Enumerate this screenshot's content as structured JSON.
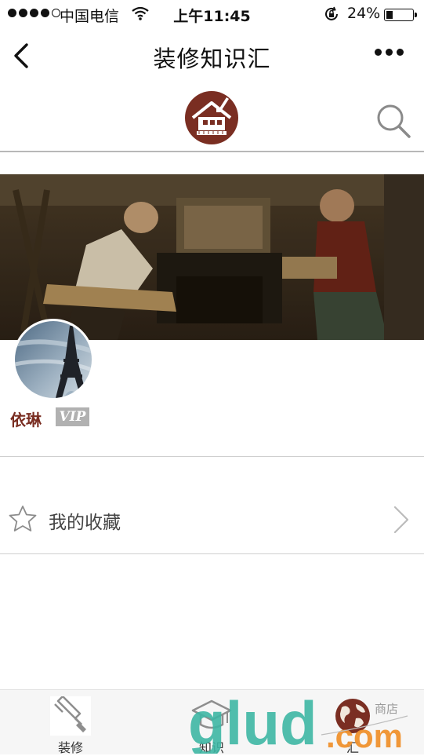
{
  "status_bar": {
    "carrier": "中国电信",
    "time": "上午11:45",
    "battery_percent": "24%",
    "battery_level": 0.24
  },
  "nav": {
    "title": "装修知识汇"
  },
  "profile": {
    "username": "依琳",
    "badge": "VIP"
  },
  "favorites": {
    "label": "我的收藏"
  },
  "tabs": [
    {
      "label": "装修",
      "icon": "paint-roller-icon"
    },
    {
      "label": "知识",
      "icon": "graduation-cap-icon"
    },
    {
      "label": "汇",
      "icon": "globe-icon"
    }
  ],
  "watermark": {
    "brand": "glud",
    "suffix": ".com",
    "shop": "商店"
  },
  "colors": {
    "brand": "#7a2e22",
    "divider": "#cfcfcf",
    "vip_badge": "#b1b1b1",
    "watermark_teal": "#3fb7a5",
    "watermark_orange": "#f0922e"
  }
}
